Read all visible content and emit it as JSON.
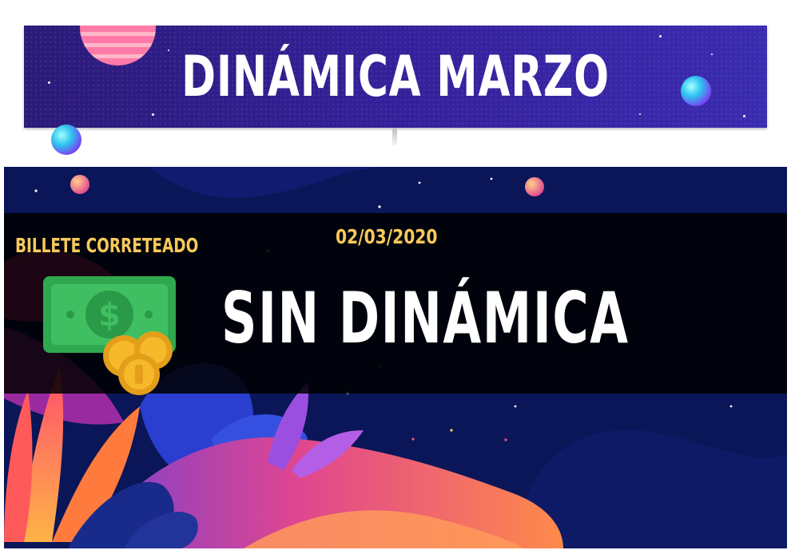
{
  "banner": {
    "title": "DINÁMICA MARZO"
  },
  "panel": {
    "category_label": "BILLETE CORRETEADO",
    "date": "02/03/2020",
    "status": "SIN DINÁMICA"
  },
  "icons": {
    "money": "money-bill-with-coins-icon"
  },
  "colors": {
    "banner_bg": "#34209a",
    "panel_bg": "#0a1550",
    "label_gold": "#f7c95a",
    "title_white": "#ffffff",
    "bill_green": "#2fa84f",
    "coin_gold": "#f5b92a"
  }
}
